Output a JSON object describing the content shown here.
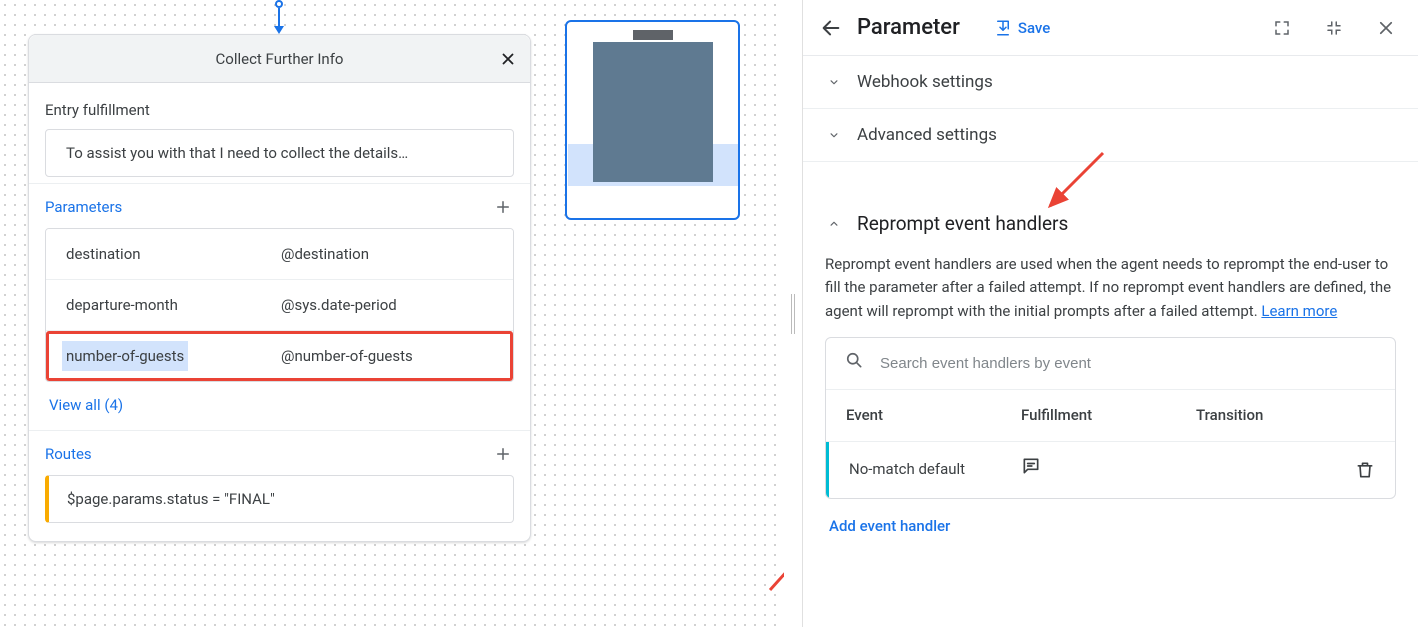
{
  "node": {
    "title": "Collect Further Info",
    "entry_label": "Entry fulfillment",
    "entry_text": "To assist you with that I need to collect the details…",
    "parameters_label": "Parameters",
    "params": [
      {
        "name": "destination",
        "type": "@destination"
      },
      {
        "name": "departure-month",
        "type": "@sys.date-period"
      },
      {
        "name": "number-of-guests",
        "type": "@number-of-guests"
      }
    ],
    "view_all": "View all (4)",
    "routes_label": "Routes",
    "route_condition": "$page.params.status = \"FINAL\""
  },
  "panel": {
    "title": "Parameter",
    "save": "Save",
    "sections": {
      "webhook": "Webhook settings",
      "advanced": "Advanced settings",
      "reprompt": "Reprompt event handlers"
    },
    "reprompt_blurb": "Reprompt event handlers are used when the agent needs to reprompt the end-user to fill the parameter after a failed attempt. If no reprompt event handlers are defined, the agent will reprompt with the initial prompts after a failed attempt. ",
    "learn_more": "Learn more",
    "search_placeholder": "Search event handlers by event",
    "th": {
      "event": "Event",
      "fulfillment": "Fulfillment",
      "transition": "Transition"
    },
    "row1_event": "No-match default",
    "add_handler": "Add event handler"
  }
}
